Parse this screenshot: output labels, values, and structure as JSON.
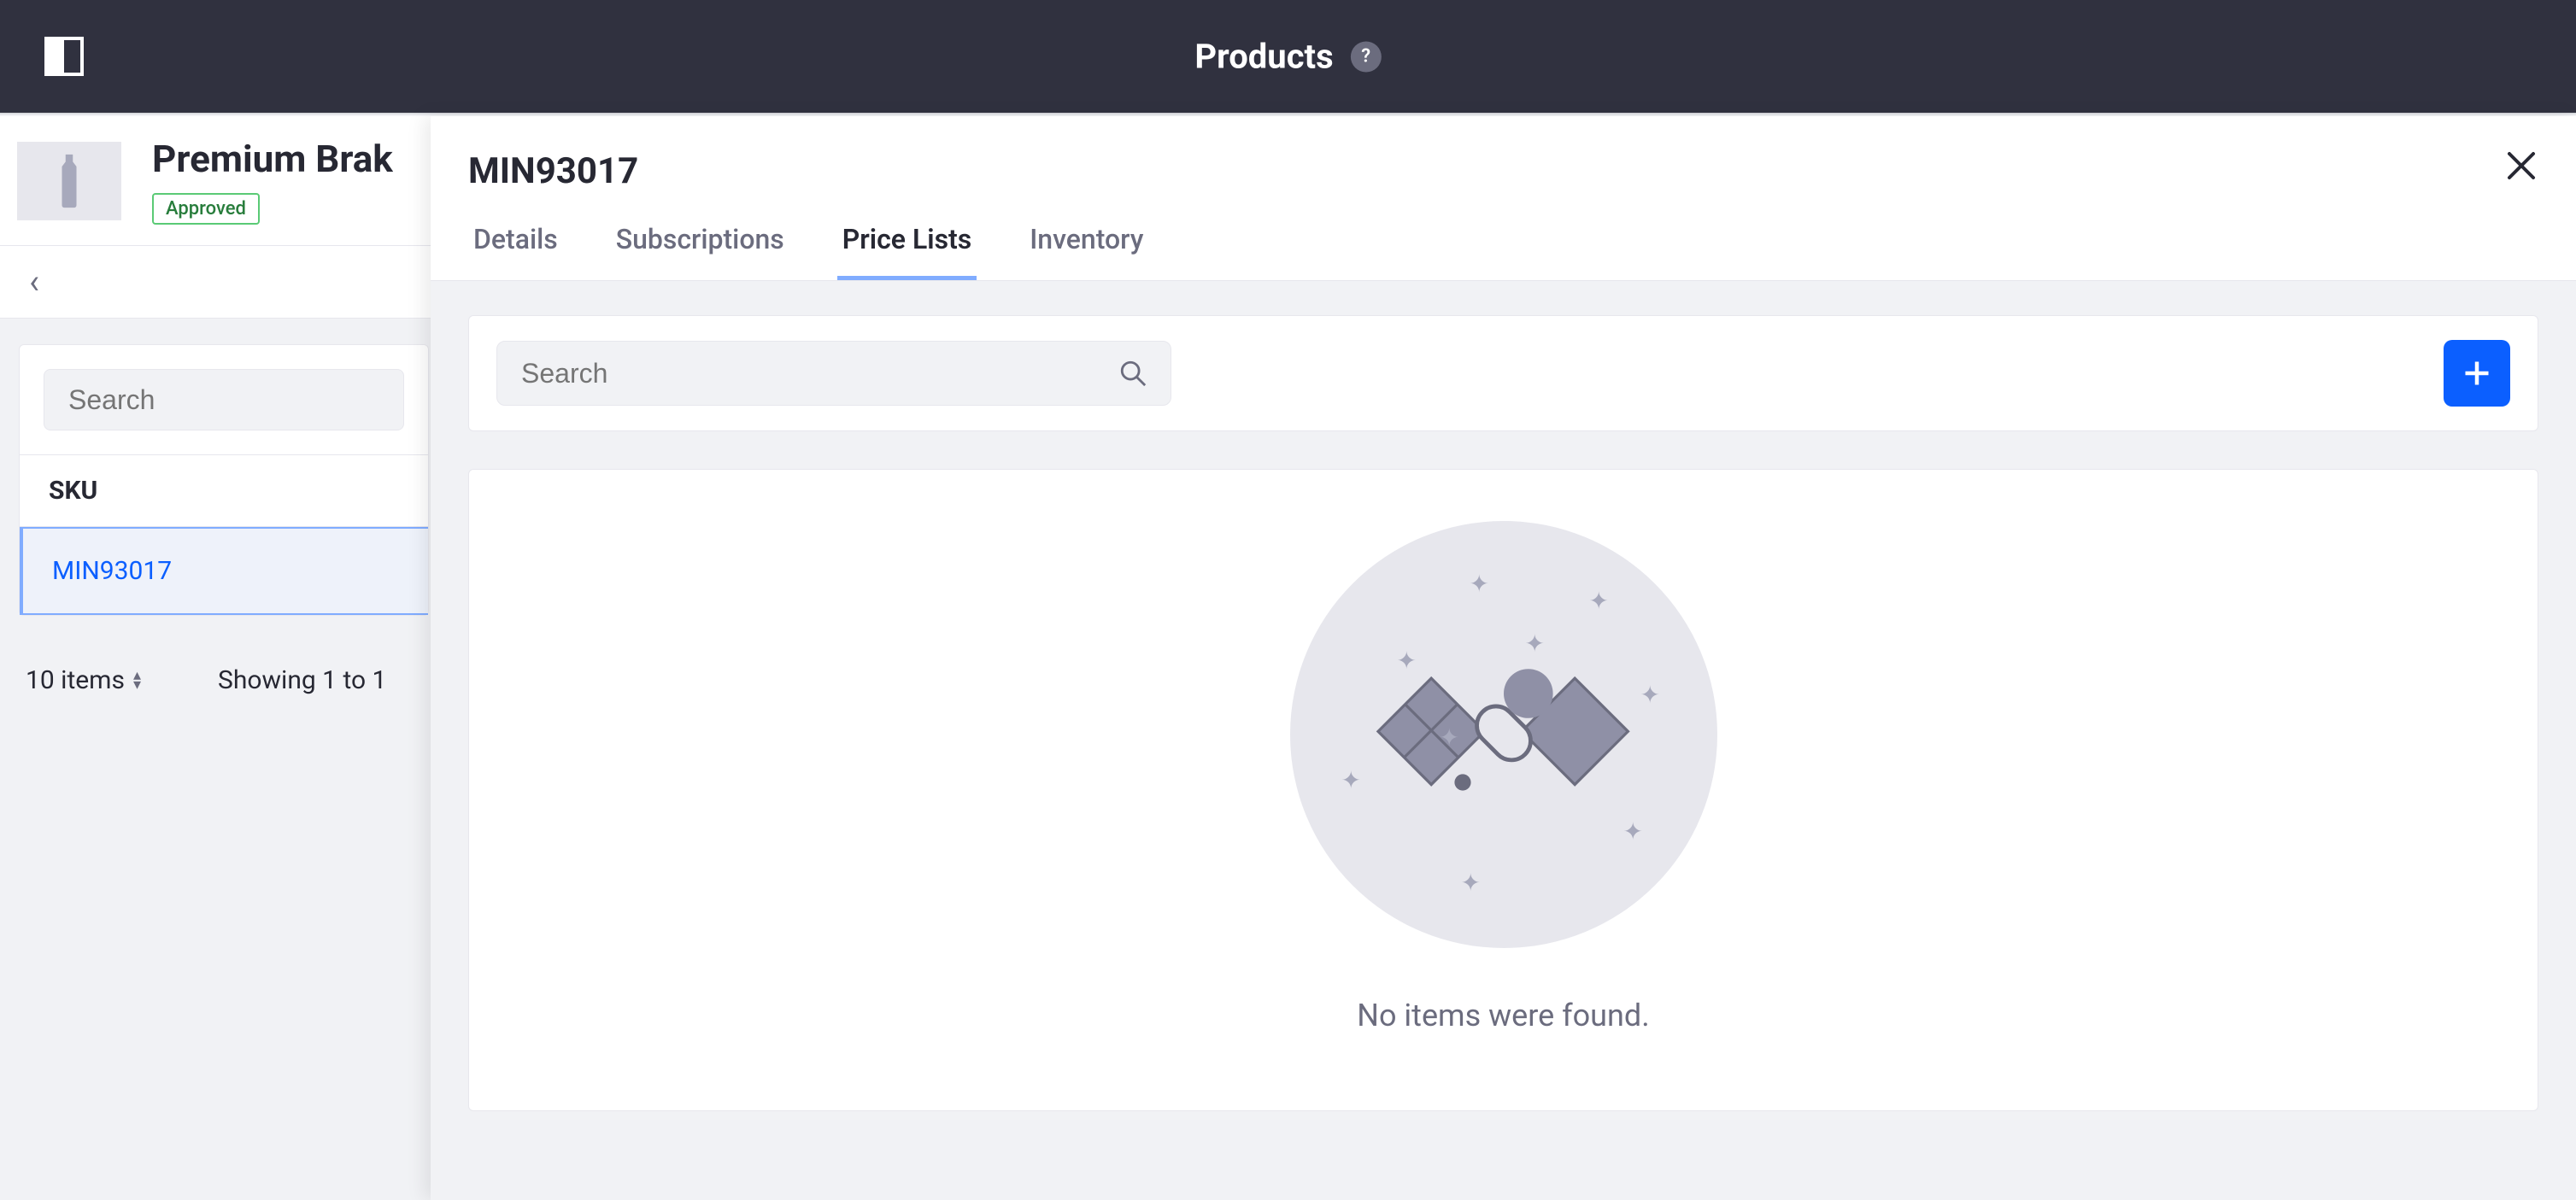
{
  "topbar": {
    "title": "Products",
    "help_symbol": "?"
  },
  "product": {
    "name": "Premium Brak",
    "status": "Approved"
  },
  "side_table": {
    "search_placeholder": "Search",
    "column_header": "SKU",
    "rows": [
      {
        "sku": "MIN93017",
        "selected": true
      }
    ],
    "items_label": "10 items",
    "showing_label": "Showing 1 to 1"
  },
  "drawer": {
    "title": "MIN93017",
    "tabs": [
      {
        "id": "details",
        "label": "Details",
        "active": false
      },
      {
        "id": "subscriptions",
        "label": "Subscriptions",
        "active": false
      },
      {
        "id": "price-lists",
        "label": "Price Lists",
        "active": true
      },
      {
        "id": "inventory",
        "label": "Inventory",
        "active": false
      }
    ],
    "search_placeholder": "Search",
    "empty_state_text": "No items were found."
  },
  "colors": {
    "primary": "#0b5fff",
    "topbar": "#30313f",
    "muted": "#6b6c7e",
    "surface": "#f1f2f5"
  }
}
